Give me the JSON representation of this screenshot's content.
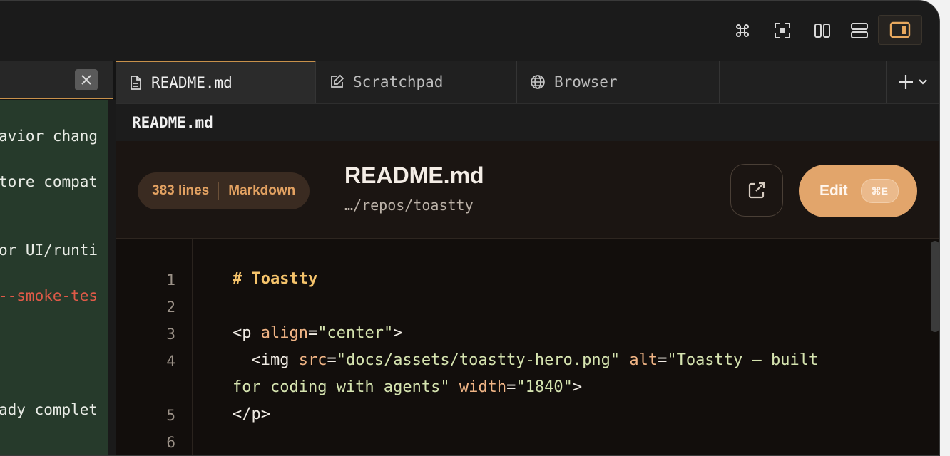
{
  "toolbar": {
    "icons": [
      "command-icon",
      "focus-icon",
      "split-columns-icon",
      "split-rows-icon",
      "right-panel-icon"
    ]
  },
  "left_pane": {
    "close_label": "✕",
    "lines": [
      {
        "text": "avior chang",
        "color": "normal"
      },
      {
        "text": "tore compat",
        "color": "normal"
      },
      {
        "text": "or UI/runti",
        "color": "normal"
      },
      {
        "text": "--smoke-tes",
        "color": "red"
      },
      {
        "text": "ady complet",
        "color": "normal"
      }
    ]
  },
  "tabs": [
    {
      "label": "README.md",
      "icon": "document-icon",
      "active": true
    },
    {
      "label": "Scratchpad",
      "icon": "edit-note-icon",
      "active": false
    },
    {
      "label": "Browser",
      "icon": "globe-icon",
      "active": false
    }
  ],
  "path_header": {
    "title": "README.md"
  },
  "file_header": {
    "lines_label": "383 lines",
    "type_label": "Markdown",
    "title": "README.md",
    "path": "…/repos/toastty",
    "edit_label": "Edit",
    "edit_shortcut": "⌘E"
  },
  "code": {
    "line_numbers": [
      "1",
      "2",
      "3",
      "4",
      "5",
      "6"
    ],
    "line1": "# Toastty",
    "line3": {
      "open": "<p ",
      "attr": "align",
      "eq": "=",
      "val": "\"center\"",
      "close": ">"
    },
    "line4a": {
      "open": "  <img ",
      "a1": "src",
      "v1": "\"docs/assets/toastty-hero.png\"",
      "a2": "alt",
      "v2": "\"Toastty — built"
    },
    "line4b": {
      "v2b": "for coding with agents\"",
      "a3": "width",
      "v3": "\"1840\"",
      "close": ">"
    },
    "line5": "</p>"
  },
  "colors": {
    "accent": "#e2a56b",
    "left_pane_bg": "#263a2b",
    "code_bg": "#120e0c"
  }
}
